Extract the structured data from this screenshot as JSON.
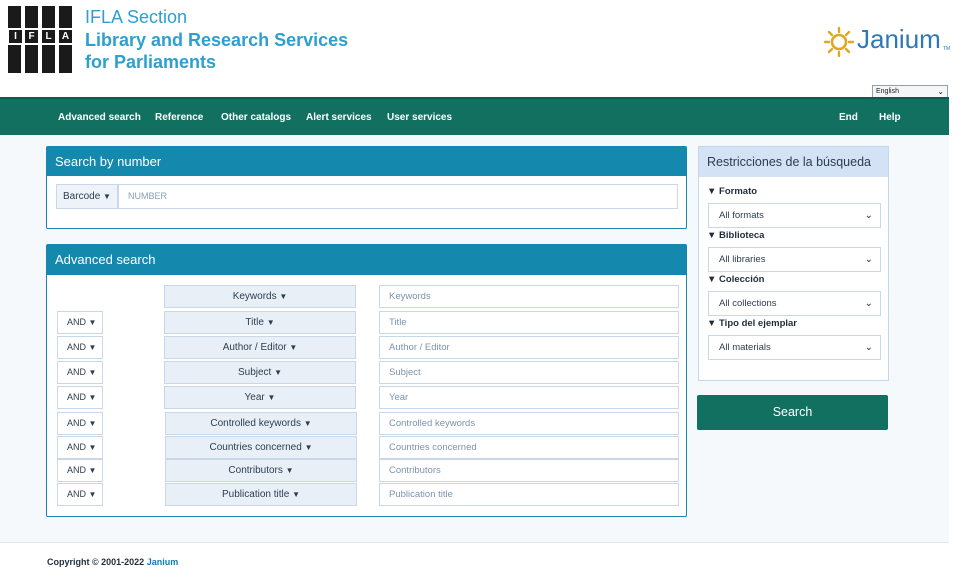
{
  "header": {
    "logo_letters": [
      "I",
      "F",
      "L",
      "A"
    ],
    "org_line1": "IFLA Section",
    "org_line2": "Library and Research Services",
    "org_line3": "for Parliaments",
    "janium_logo": "Janium",
    "janium_tm": "TM",
    "language": "English"
  },
  "nav": {
    "items": [
      "Advanced search",
      "Reference",
      "Other catalogs",
      "Alert services",
      "User services"
    ],
    "right_items": [
      "End",
      "Help"
    ]
  },
  "search_by_number": {
    "title": "Search by number",
    "type_label": "Barcode",
    "placeholder": "NUMBER"
  },
  "advanced_search": {
    "title": "Advanced search",
    "rows": [
      {
        "operator": "",
        "field": "Keywords",
        "placeholder": "Keywords"
      },
      {
        "operator": "AND",
        "field": "Title",
        "placeholder": "Title"
      },
      {
        "operator": "AND",
        "field": "Author / Editor",
        "placeholder": "Author / Editor"
      },
      {
        "operator": "AND",
        "field": "Subject",
        "placeholder": "Subject"
      },
      {
        "operator": "AND",
        "field": "Year",
        "placeholder": "Year"
      },
      {
        "operator": "AND",
        "field": "Controlled keywords",
        "placeholder": "Controlled keywords"
      },
      {
        "operator": "AND",
        "field": "Countries concerned",
        "placeholder": "Countries concerned"
      },
      {
        "operator": "AND",
        "field": "Contributors",
        "placeholder": "Contributors"
      },
      {
        "operator": "AND",
        "field": "Publication title",
        "placeholder": "Publication title"
      }
    ]
  },
  "restrictions": {
    "title": "Restricciones de la búsqueda",
    "filters": [
      {
        "label": "Formato",
        "value": "All formats"
      },
      {
        "label": "Biblioteca",
        "value": "All libraries"
      },
      {
        "label": "Colección",
        "value": "All collections"
      },
      {
        "label": "Tipo del ejemplar",
        "value": "All materials"
      }
    ]
  },
  "search_button": "Search",
  "footer": {
    "copyright": "Copyright © 2001-2022",
    "brand": "Janium"
  },
  "colors": {
    "nav_green": "#127061",
    "panel_blue": "#1588ad",
    "restrictions_header": "#d3e2f4",
    "ifla_blue": "#2e9fd0",
    "janium_gold": "#e0a81c"
  }
}
